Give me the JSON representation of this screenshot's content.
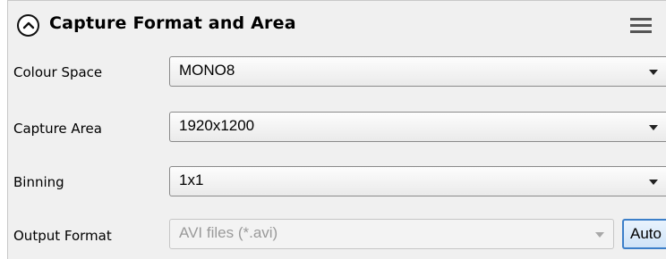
{
  "panel": {
    "title": "Capture Format and Area"
  },
  "icons": {
    "collapse": "chevron-up-circle-icon",
    "menu": "hamburger-menu-icon"
  },
  "rows": [
    {
      "label": "Colour Space",
      "value": "MONO8"
    },
    {
      "label": "Capture Area",
      "value": "1920x1200"
    },
    {
      "label": "Binning",
      "value": "1x1"
    },
    {
      "label": "Output Format",
      "value": "AVI files (*.avi)",
      "disabled": true
    }
  ],
  "auto_button": {
    "label": "Auto"
  }
}
